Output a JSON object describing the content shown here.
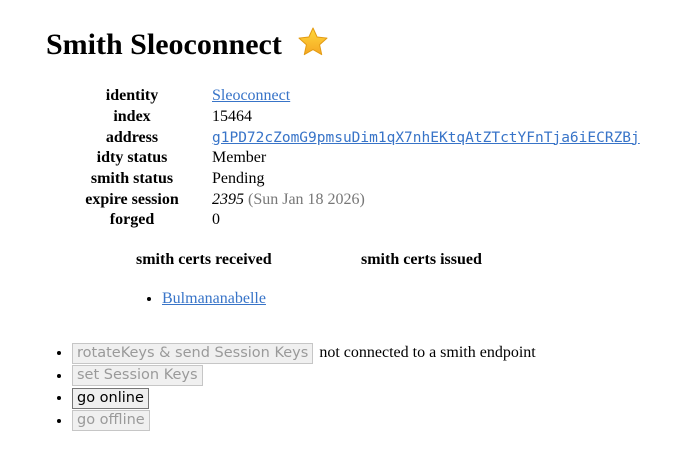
{
  "title": "Smith Sleoconnect",
  "title_icon": "star-icon",
  "info": [
    {
      "key": "identity",
      "value": "Sleoconnect",
      "type": "link"
    },
    {
      "key": "index",
      "value": "15464"
    },
    {
      "key": "address",
      "value": "g1PD72cZomG9pmsuDim1qX7nhEKtqAtZTctYFnTja6iECRZBj",
      "type": "mono-link"
    },
    {
      "key": "idty status",
      "value": "Member"
    },
    {
      "key": "smith status",
      "value": "Pending"
    },
    {
      "key": "expire session",
      "value": "2395",
      "note": "(Sun Jan 18 2026)"
    },
    {
      "key": "forged",
      "value": "0"
    }
  ],
  "certs": {
    "received_title": "smith certs received",
    "issued_title": "smith certs issued",
    "received": [
      "Bulmananabelle"
    ]
  },
  "actions": {
    "rotate_label": "rotateKeys & send Session Keys",
    "rotate_status": "not connected to a smith endpoint",
    "set_keys_label": "set Session Keys",
    "online_label": "go online",
    "offline_label": "go offline"
  },
  "colors": {
    "link": "#3874c8",
    "disabled_text": "#9a9a9a"
  }
}
